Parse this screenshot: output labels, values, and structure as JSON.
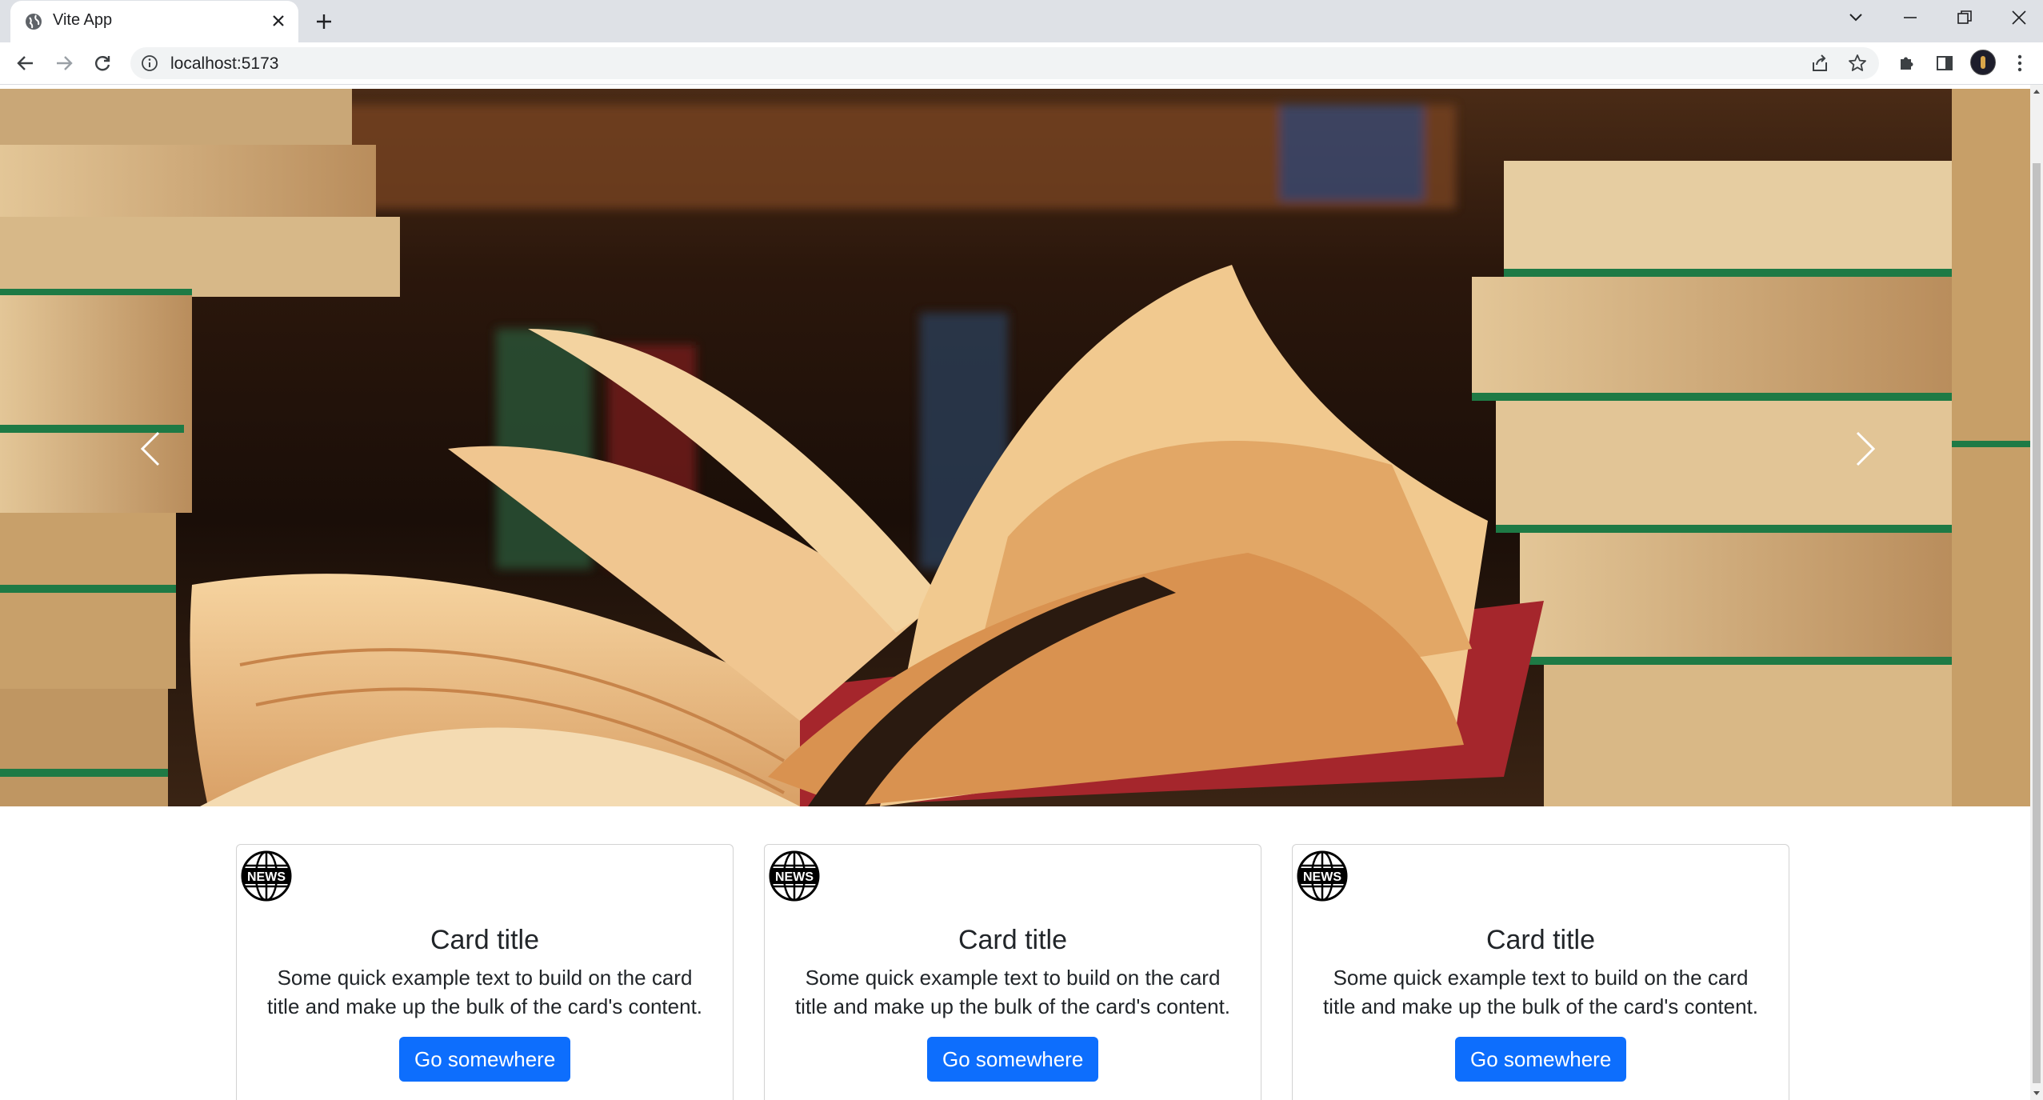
{
  "browser": {
    "tab_title": "Vite App",
    "url": "localhost:5173"
  },
  "icons": {
    "tab_favicon": "globe-icon",
    "tab_close": "close-icon",
    "new_tab": "plus-icon",
    "tab_search": "chevron-down-icon",
    "minimize": "minimize-icon",
    "restore": "restore-icon",
    "close_window": "close-icon",
    "back": "back-arrow-icon",
    "forward": "forward-arrow-icon",
    "reload": "reload-icon",
    "site_info": "info-icon",
    "share": "share-icon",
    "bookmark": "star-icon",
    "extensions": "puzzle-icon",
    "side_panel": "side-panel-icon",
    "profile": "avatar",
    "menu": "kebab-menu-icon",
    "carousel_prev": "chevron-left-icon",
    "carousel_next": "chevron-right-icon",
    "card_logo": "news-globe-icon"
  },
  "carousel": {
    "image_label": "open book surrounded by stacks of books"
  },
  "cards": [
    {
      "logo_text": "NEWS",
      "title": "Card title",
      "text": "Some quick example text to build on the card title and make up the bulk of the card's content.",
      "button": "Go somewhere"
    },
    {
      "logo_text": "NEWS",
      "title": "Card title",
      "text": "Some quick example text to build on the card title and make up the bulk of the card's content.",
      "button": "Go somewhere"
    },
    {
      "logo_text": "NEWS",
      "title": "Card title",
      "text": "Some quick example text to build on the card title and make up the bulk of the card's content.",
      "button": "Go somewhere"
    }
  ],
  "colors": {
    "primary": "#0d6efd",
    "tabstrip": "#dee1e6",
    "text": "#212529"
  }
}
